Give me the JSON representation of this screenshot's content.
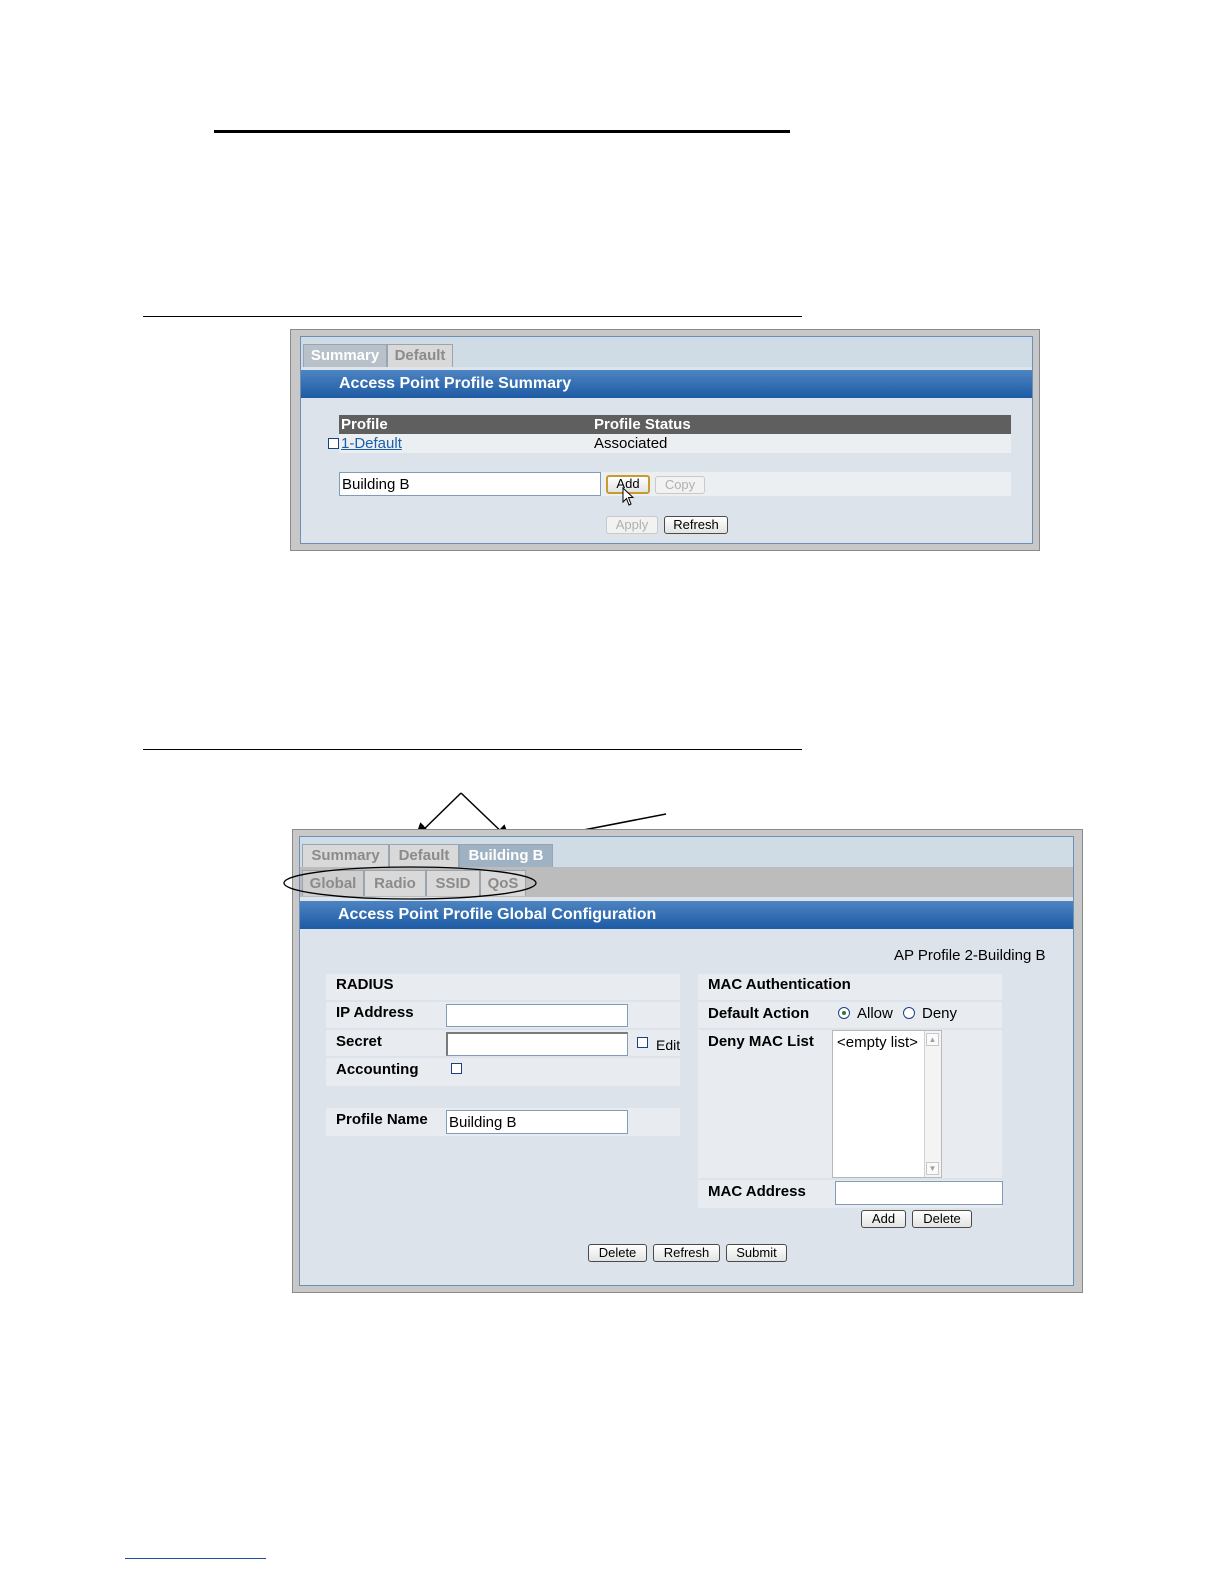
{
  "figure1": {
    "tabs": [
      "Summary",
      "Default"
    ],
    "title": "Access Point Profile Summary",
    "columns": [
      "Profile",
      "Profile Status"
    ],
    "rows": [
      {
        "profile": "1-Default",
        "status": "Associated"
      }
    ],
    "new_profile_value": "Building B",
    "add_label": "Add",
    "copy_label": "Copy",
    "apply_label": "Apply",
    "refresh_label": "Refresh"
  },
  "figure2": {
    "tabs": [
      "Summary",
      "Default",
      "Building B"
    ],
    "subtabs": [
      "Global",
      "Radio",
      "SSID",
      "QoS"
    ],
    "title": "Access Point Profile Global Configuration",
    "profile_caption": "AP Profile 2-Building B",
    "radius": {
      "heading": "RADIUS",
      "ip_label": "IP Address",
      "ip_value": "",
      "secret_label": "Secret",
      "secret_value": "",
      "edit_label": "Edit",
      "accounting_label": "Accounting"
    },
    "profile_name_label": "Profile Name",
    "profile_name_value": "Building B",
    "mac": {
      "heading": "MAC Authentication",
      "default_action_label": "Default Action",
      "allow_label": "Allow",
      "deny_label": "Deny",
      "selected_action": "Allow",
      "deny_list_label": "Deny MAC List",
      "deny_list_items": [
        "<empty list>"
      ],
      "mac_address_label": "MAC Address",
      "mac_address_value": "",
      "add_label": "Add",
      "delete_label": "Delete"
    },
    "buttons": {
      "delete_label": "Delete",
      "refresh_label": "Refresh",
      "submit_label": "Submit"
    }
  }
}
